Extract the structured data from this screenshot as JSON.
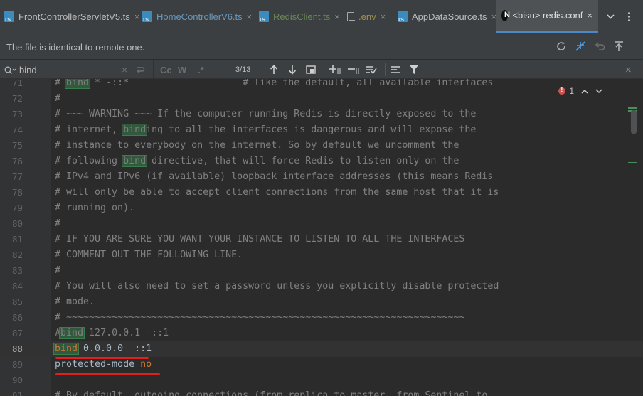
{
  "tabs": [
    {
      "label": "FrontControllerServletV5.ts",
      "icon": "ts-file-icon",
      "color": "#bbbbbb"
    },
    {
      "label": "HomeControllerV6.ts",
      "icon": "ts-file-icon",
      "color": "#6897bb"
    },
    {
      "label": "RedisClient.ts",
      "icon": "ts-file-icon",
      "color": "#6a8759"
    },
    {
      "label": ".env",
      "icon": "text-file-icon",
      "color": "#a08f4e"
    },
    {
      "label": "AppDataSource.ts",
      "icon": "ts-file-icon",
      "color": "#bbbbbb"
    },
    {
      "label": "<bisu> redis.conf",
      "icon": "nginx-file-icon",
      "color": "#dddddd"
    }
  ],
  "tab_close_glyph": "×",
  "infobar": {
    "message": "The file is identical to remote one."
  },
  "search": {
    "value": "bind",
    "match_count": "3/13",
    "case_label": "Cc",
    "words_label": "W",
    "regex_label": ".*"
  },
  "editor": {
    "error_count": "1",
    "lines": [
      {
        "n": "71",
        "segs": [
          {
            "t": "# ",
            "c": "comment"
          },
          {
            "t": "bind",
            "c": "hl"
          },
          {
            "t": " * -::*                    # like the default, all available interfaces",
            "c": "comment"
          }
        ]
      },
      {
        "n": "72",
        "segs": [
          {
            "t": "#",
            "c": "comment"
          }
        ]
      },
      {
        "n": "73",
        "segs": [
          {
            "t": "# ~~~ WARNING ~~~ If the computer running Redis is directly exposed to the",
            "c": "comment"
          }
        ]
      },
      {
        "n": "74",
        "segs": [
          {
            "t": "# internet, ",
            "c": "comment"
          },
          {
            "t": "bind",
            "c": "hl"
          },
          {
            "t": "ing to all the interfaces is dangerous and will expose the",
            "c": "comment"
          }
        ]
      },
      {
        "n": "75",
        "segs": [
          {
            "t": "# instance to everybody on the internet. So by default we uncomment the",
            "c": "comment"
          }
        ]
      },
      {
        "n": "76",
        "segs": [
          {
            "t": "# following ",
            "c": "comment"
          },
          {
            "t": "bind",
            "c": "hl"
          },
          {
            "t": " directive, that will force Redis to listen only on the",
            "c": "comment"
          }
        ]
      },
      {
        "n": "77",
        "segs": [
          {
            "t": "# IPv4 and IPv6 (if available) loopback interface addresses (this means Redis",
            "c": "comment"
          }
        ]
      },
      {
        "n": "78",
        "segs": [
          {
            "t": "# will only be able to accept client connections from the same host that it is",
            "c": "comment"
          }
        ]
      },
      {
        "n": "79",
        "segs": [
          {
            "t": "# running on).",
            "c": "comment"
          }
        ]
      },
      {
        "n": "80",
        "segs": [
          {
            "t": "#",
            "c": "comment"
          }
        ]
      },
      {
        "n": "81",
        "segs": [
          {
            "t": "# IF YOU ARE SURE YOU WANT YOUR INSTANCE TO LISTEN TO ALL THE INTERFACES",
            "c": "comment"
          }
        ]
      },
      {
        "n": "82",
        "segs": [
          {
            "t": "# COMMENT OUT THE FOLLOWING LINE.",
            "c": "comment"
          }
        ]
      },
      {
        "n": "83",
        "segs": [
          {
            "t": "#",
            "c": "comment"
          }
        ]
      },
      {
        "n": "84",
        "segs": [
          {
            "t": "# You will also need to set a password unless you explicitly disable protected",
            "c": "comment"
          }
        ]
      },
      {
        "n": "85",
        "segs": [
          {
            "t": "# mode.",
            "c": "comment"
          }
        ]
      },
      {
        "n": "86",
        "segs": [
          {
            "t": "# ~~~~~~~~~~~~~~~~~~~~~~~~~~~~~~~~~~~~~~~~~~~~~~~~~~~~~~~~~~~~~~~~~~~~~~",
            "c": "comment"
          }
        ]
      },
      {
        "n": "87",
        "segs": [
          {
            "t": "#",
            "c": "comment"
          },
          {
            "t": "bind",
            "c": "hl"
          },
          {
            "t": " 127.0.0.1 -::1",
            "c": "comment"
          }
        ]
      },
      {
        "n": "88",
        "current": true,
        "segs": [
          {
            "t": "bind",
            "c": "keyhl"
          },
          {
            "t": " 0.0.0.0  ::1",
            "c": "plain"
          }
        ]
      },
      {
        "n": "89",
        "segs": [
          {
            "t": "protected-mode",
            "c": "plain"
          },
          {
            "t": " ",
            "c": "plain"
          },
          {
            "t": "no",
            "c": "key"
          }
        ]
      },
      {
        "n": "90",
        "segs": []
      },
      {
        "n": "91",
        "segs": [
          {
            "t": "# By default, outgoing connections (from replica to master, from Sentinel to",
            "c": "comment"
          }
        ]
      }
    ]
  }
}
